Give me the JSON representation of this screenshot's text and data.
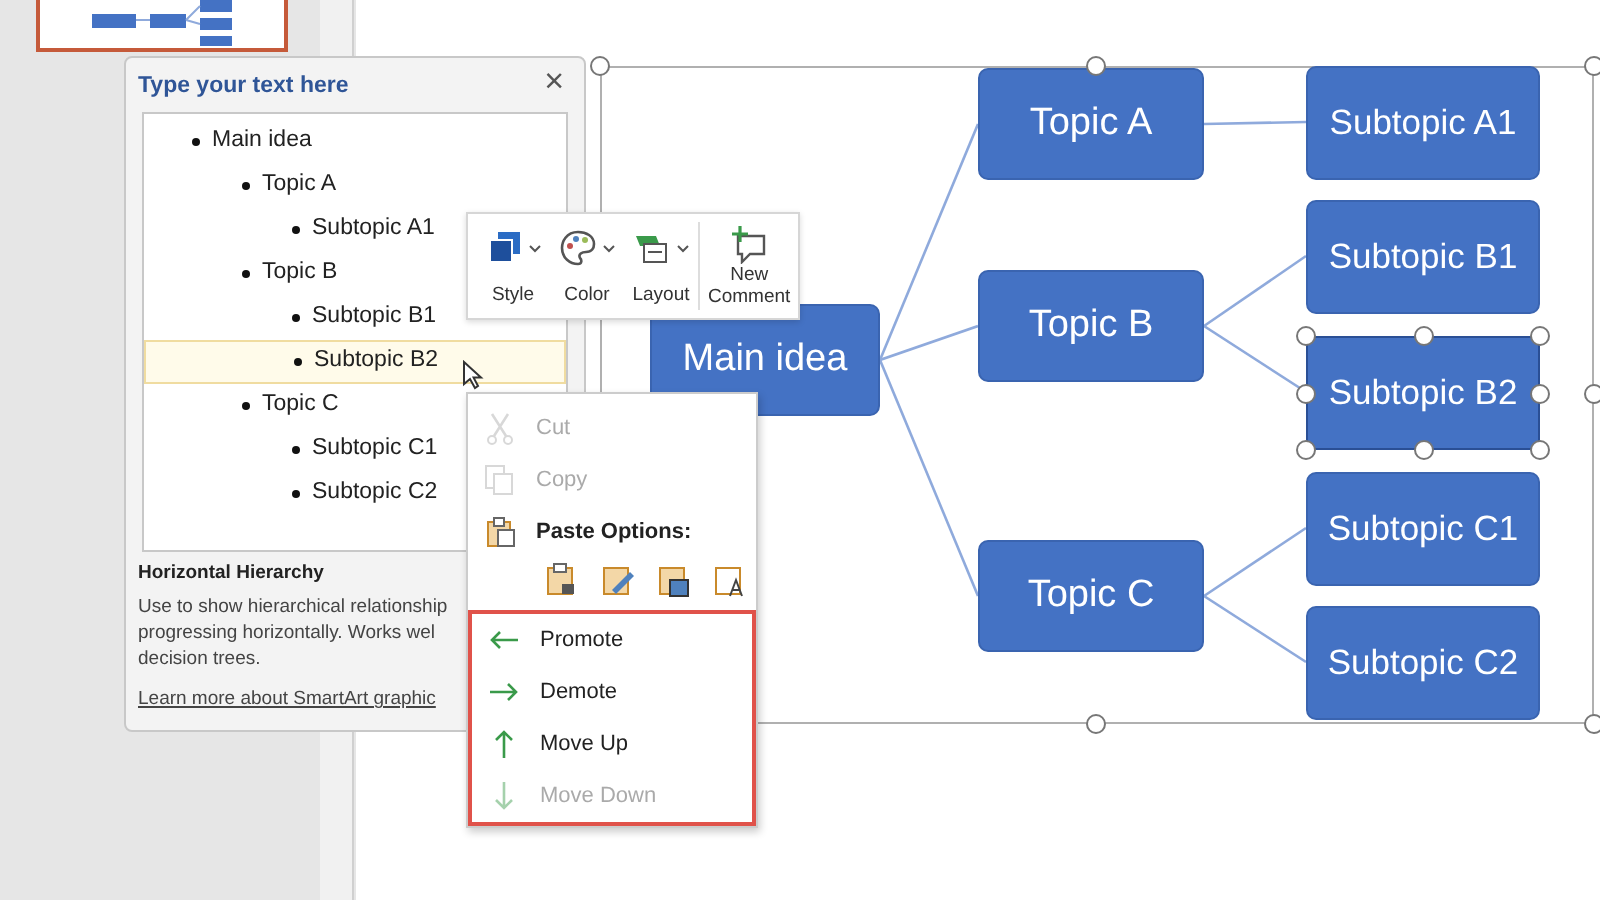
{
  "text_pane": {
    "title": "Type your text here",
    "close": "×",
    "items": [
      {
        "text": "Main idea",
        "selected": false,
        "children": [
          {
            "text": "Topic A",
            "selected": false,
            "children": [
              {
                "text": "Subtopic A1",
                "selected": false
              }
            ]
          },
          {
            "text": "Topic B",
            "selected": false,
            "children": [
              {
                "text": "Subtopic B1",
                "selected": false
              },
              {
                "text": "Subtopic B2",
                "selected": true
              }
            ]
          },
          {
            "text": "Topic C",
            "selected": false,
            "children": [
              {
                "text": "Subtopic C1",
                "selected": false
              },
              {
                "text": "Subtopic C2",
                "selected": false
              }
            ]
          }
        ]
      }
    ],
    "info": {
      "title": "Horizontal Hierarchy",
      "lines": [
        "Use to show hierarchical relationship",
        "progressing horizontally. Works wel",
        "decision trees."
      ],
      "link": "Learn more about SmartArt graphic"
    }
  },
  "mini_toolbar": [
    {
      "label": "Style",
      "kind": "style"
    },
    {
      "label": "Color",
      "kind": "color"
    },
    {
      "label": "Layout",
      "kind": "layout"
    },
    {
      "label": "New Comment",
      "kind": "comment"
    }
  ],
  "context_menu": [
    {
      "kind": "item",
      "label": "Cut",
      "disabled": true,
      "highlighted": false
    },
    {
      "kind": "item",
      "label": "Copy",
      "disabled": true,
      "highlighted": false
    },
    {
      "kind": "header",
      "label": "Paste Options:",
      "highlighted": false
    },
    {
      "kind": "paste-icons"
    },
    {
      "kind": "item",
      "label": "Promote",
      "disabled": false,
      "highlighted": true
    },
    {
      "kind": "item",
      "label": "Demote",
      "disabled": false,
      "highlighted": true
    },
    {
      "kind": "item",
      "label": "Move Up",
      "disabled": false,
      "highlighted": true
    },
    {
      "kind": "item",
      "label": "Move Down",
      "disabled": true,
      "highlighted": true
    }
  ],
  "diagram": {
    "selected": true,
    "main": {
      "text": "Main idea",
      "selected": false
    },
    "topics": [
      {
        "text": "Topic A",
        "selected": false,
        "children": [
          {
            "text": "Subtopic A1",
            "selected": false
          }
        ]
      },
      {
        "text": "Topic B",
        "selected": false,
        "children": [
          {
            "text": "Subtopic B1",
            "selected": false
          },
          {
            "text": "Subtopic B2",
            "selected": true
          }
        ]
      },
      {
        "text": "Topic C",
        "selected": false,
        "children": [
          {
            "text": "Subtopic C1",
            "selected": false
          },
          {
            "text": "Subtopic C2",
            "selected": false
          }
        ]
      }
    ]
  }
}
